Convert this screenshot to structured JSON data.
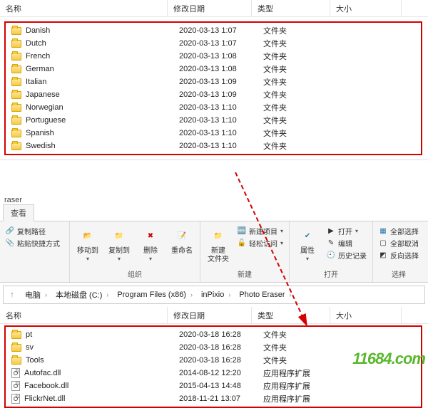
{
  "headers": {
    "name": "名称",
    "date": "修改日期",
    "type": "类型",
    "size": "大小"
  },
  "top_rows": [
    {
      "name": "Danish",
      "date": "2020-03-13 1:07",
      "type": "文件夹"
    },
    {
      "name": "Dutch",
      "date": "2020-03-13 1:07",
      "type": "文件夹"
    },
    {
      "name": "French",
      "date": "2020-03-13 1:08",
      "type": "文件夹"
    },
    {
      "name": "German",
      "date": "2020-03-13 1:08",
      "type": "文件夹"
    },
    {
      "name": "Italian",
      "date": "2020-03-13 1:09",
      "type": "文件夹"
    },
    {
      "name": "Japanese",
      "date": "2020-03-13 1:09",
      "type": "文件夹"
    },
    {
      "name": "Norwegian",
      "date": "2020-03-13 1:10",
      "type": "文件夹"
    },
    {
      "name": "Portuguese",
      "date": "2020-03-13 1:10",
      "type": "文件夹"
    },
    {
      "name": "Spanish",
      "date": "2020-03-13 1:10",
      "type": "文件夹"
    },
    {
      "name": "Swedish",
      "date": "2020-03-13 1:10",
      "type": "文件夹"
    }
  ],
  "window_title": "raser",
  "tab": {
    "view": "查看"
  },
  "ribbon": {
    "clipboard": {
      "copy_path": "复制路径",
      "paste_shortcut": "粘贴快捷方式"
    },
    "organize": {
      "move_to": "移动到",
      "copy_to": "复制到",
      "delete": "删除",
      "rename": "重命名",
      "label": "组织"
    },
    "new": {
      "new_folder": "新建\n文件夹",
      "new_item": "新建项目",
      "easy_access": "轻松访问",
      "label": "新建"
    },
    "open": {
      "properties": "属性",
      "open": "打开",
      "edit": "编辑",
      "history": "历史记录",
      "label": "打开"
    },
    "select": {
      "select_all": "全部选择",
      "select_none": "全部取消",
      "invert": "反向选择",
      "label": "选择"
    }
  },
  "breadcrumb": [
    "电脑",
    "本地磁盘 (C:)",
    "Program Files (x86)",
    "inPixio",
    "Photo Eraser"
  ],
  "bottom_rows": [
    {
      "icon": "folder",
      "name": "pt",
      "date": "2020-03-18 16:28",
      "type": "文件夹"
    },
    {
      "icon": "folder",
      "name": "sv",
      "date": "2020-03-18 16:28",
      "type": "文件夹"
    },
    {
      "icon": "folder",
      "name": "Tools",
      "date": "2020-03-18 16:28",
      "type": "文件夹"
    },
    {
      "icon": "file",
      "name": "Autofac.dll",
      "date": "2014-08-12 12:20",
      "type": "应用程序扩展"
    },
    {
      "icon": "file",
      "name": "Facebook.dll",
      "date": "2015-04-13 14:48",
      "type": "应用程序扩展"
    },
    {
      "icon": "file",
      "name": "FlickrNet.dll",
      "date": "2018-11-21 13:07",
      "type": "应用程序扩展"
    }
  ],
  "watermark": "11684.com"
}
